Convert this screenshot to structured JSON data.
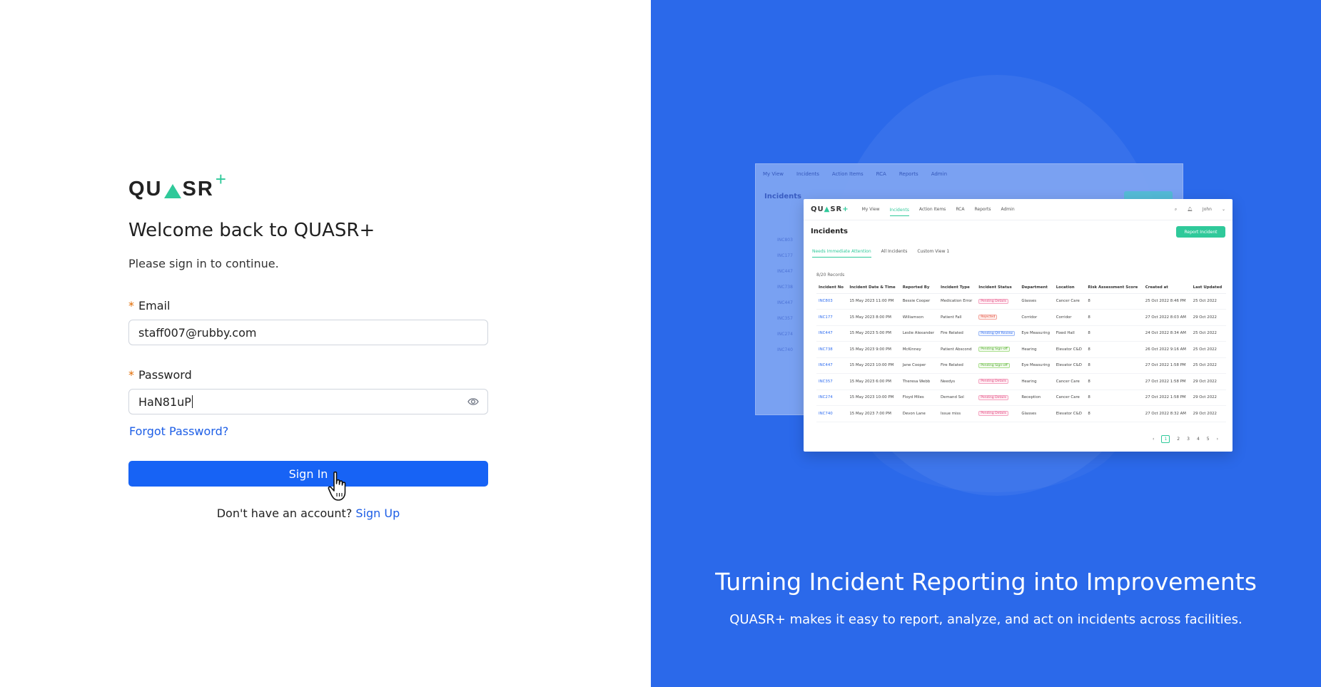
{
  "brand": {
    "name_part1": "QU",
    "name_part2": "SR",
    "plus": "+"
  },
  "login": {
    "heading": "Welcome back to QUASR+",
    "subheading": "Please sign in to continue.",
    "required_mark": "*",
    "email_label": "Email",
    "email_value": "staff007@rubby.com",
    "password_label": "Password",
    "password_value": "HaN81uP",
    "forgot_label": "Forgot Password?",
    "signin_label": "Sign In",
    "no_account_text": "Don't have an account?",
    "signup_label": "Sign Up"
  },
  "promo": {
    "title": "Turning Incident Reporting into Improvements",
    "subtitle": "QUASR+ makes it easy to report, analyze, and act on incidents across facilities.",
    "preview": {
      "nav": [
        "My View",
        "Incidents",
        "Action Items",
        "RCA",
        "Reports",
        "Admin"
      ],
      "user": "John",
      "title": "Incidents",
      "report_button": "Report Incident",
      "tabs": [
        "Needs Immediate Attention",
        "All Incidents",
        "Custom View 1"
      ],
      "record_count": "8/20 Records",
      "columns": [
        "Incident No",
        "Incident Date & Time",
        "Reported By",
        "Incident Type",
        "Incident Status",
        "Department",
        "Location",
        "Risk Assessment Score",
        "Created at",
        "Last Updated"
      ],
      "rows": [
        [
          "INC803",
          "15 May 2023 11:00 PM",
          "Bessie Cooper",
          "Medication Error",
          "Pending Details",
          "Glasses",
          "Cancer Care",
          "8",
          "25 Oct 2022 8:46 PM",
          "25 Oct 2022"
        ],
        [
          "INC177",
          "15 May 2023 8:00 PM",
          "Williamson",
          "Patient Fall",
          "Rejected",
          "Corridor",
          "Corridor",
          "8",
          "27 Oct 2022 8:03 AM",
          "29 Oct 2022"
        ],
        [
          "INC447",
          "15 May 2023 5:00 PM",
          "Leslie Alexander",
          "Fire Related",
          "Pending QH Review",
          "Eye Measuring",
          "Fixed Hall",
          "8",
          "24 Oct 2022 8:34 AM",
          "25 Oct 2022"
        ],
        [
          "INC738",
          "15 May 2023 9:00 PM",
          "McKinney",
          "Patient Abscond",
          "Pending Sign-off",
          "Hearing",
          "Elevator C&D",
          "8",
          "26 Oct 2022 9:16 AM",
          "25 Oct 2022"
        ],
        [
          "INC447",
          "15 May 2023 10:00 PM",
          "Jane Cooper",
          "Fire Related",
          "Pending Sign-off",
          "Eye Measuring",
          "Elevator C&D",
          "8",
          "27 Oct 2022 1:58 PM",
          "25 Oct 2022"
        ],
        [
          "INC357",
          "15 May 2023 6:00 PM",
          "Theresa Webb",
          "Needys",
          "Pending Details",
          "Hearing",
          "Cancer Care",
          "8",
          "27 Oct 2022 1:58 PM",
          "29 Oct 2022"
        ],
        [
          "INC274",
          "15 May 2023 10:00 PM",
          "Floyd Miles",
          "Demand Sol",
          "Pending Details",
          "Reception",
          "Cancer Care",
          "8",
          "27 Oct 2022 1:58 PM",
          "29 Oct 2022"
        ],
        [
          "INC740",
          "15 May 2023 7:00 PM",
          "Devon Lane",
          "Issue miss",
          "Pending Details",
          "Glasses",
          "Elevator C&D",
          "8",
          "27 Oct 2022 8:32 AM",
          "29 Oct 2022"
        ]
      ],
      "status_colors": [
        "pink",
        "red",
        "blue",
        "green",
        "green",
        "pink",
        "pink",
        "pink"
      ],
      "pages": [
        "1",
        "2",
        "3",
        "4",
        "5"
      ],
      "back_rows": [
        "INC803",
        "INC177",
        "INC447",
        "INC738",
        "INC447",
        "INC357",
        "INC274",
        "INC740"
      ]
    }
  },
  "colors": {
    "accent": "#1763f5",
    "brand_green": "#2fc99a",
    "right_bg": "#2b69ea",
    "link": "#1d5ee6"
  }
}
